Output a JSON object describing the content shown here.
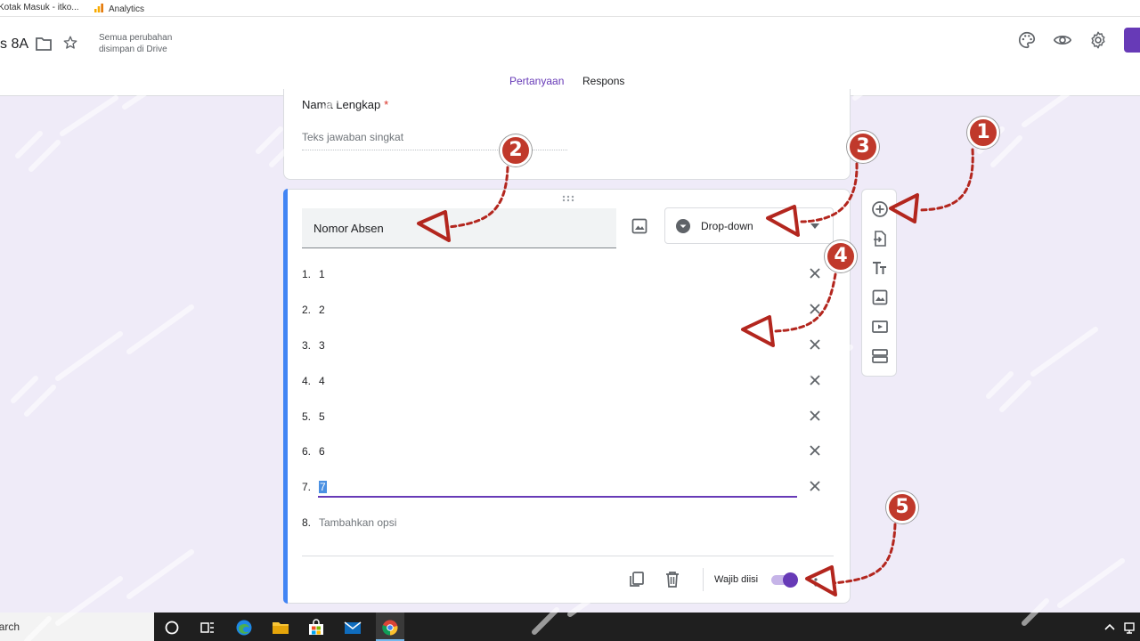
{
  "bookmarks": [
    {
      "label": "Kotak Masuk - itko..."
    },
    {
      "label": "Analytics"
    }
  ],
  "header": {
    "doc_title": "s 8A",
    "save_status_line1": "Semua perubahan",
    "save_status_line2": "disimpan di Drive",
    "tabs": [
      {
        "label": "Pertanyaan",
        "active": true
      },
      {
        "label": "Respons",
        "active": false
      }
    ]
  },
  "question1": {
    "title": "Nama Lengkap",
    "required_mark": "*",
    "answer_placeholder": "Teks jawaban singkat"
  },
  "question2": {
    "title": "Nomor Absen",
    "type_label": "Drop-down",
    "options": [
      {
        "num": "1.",
        "value": "1"
      },
      {
        "num": "2.",
        "value": "2"
      },
      {
        "num": "3.",
        "value": "3"
      },
      {
        "num": "4.",
        "value": "4"
      },
      {
        "num": "5.",
        "value": "5"
      },
      {
        "num": "6.",
        "value": "6"
      },
      {
        "num": "7.",
        "value": "7"
      }
    ],
    "add_option": {
      "num": "8.",
      "label": "Tambahkan opsi"
    },
    "required_label": "Wajib diisi",
    "required_on": true
  },
  "taskbar": {
    "search_text": "earch"
  },
  "annotations": [
    "1",
    "2",
    "3",
    "4",
    "5"
  ],
  "colors": {
    "accent": "#673ab7",
    "focus_bar": "#4285f4",
    "annotation": "#c0392b"
  }
}
